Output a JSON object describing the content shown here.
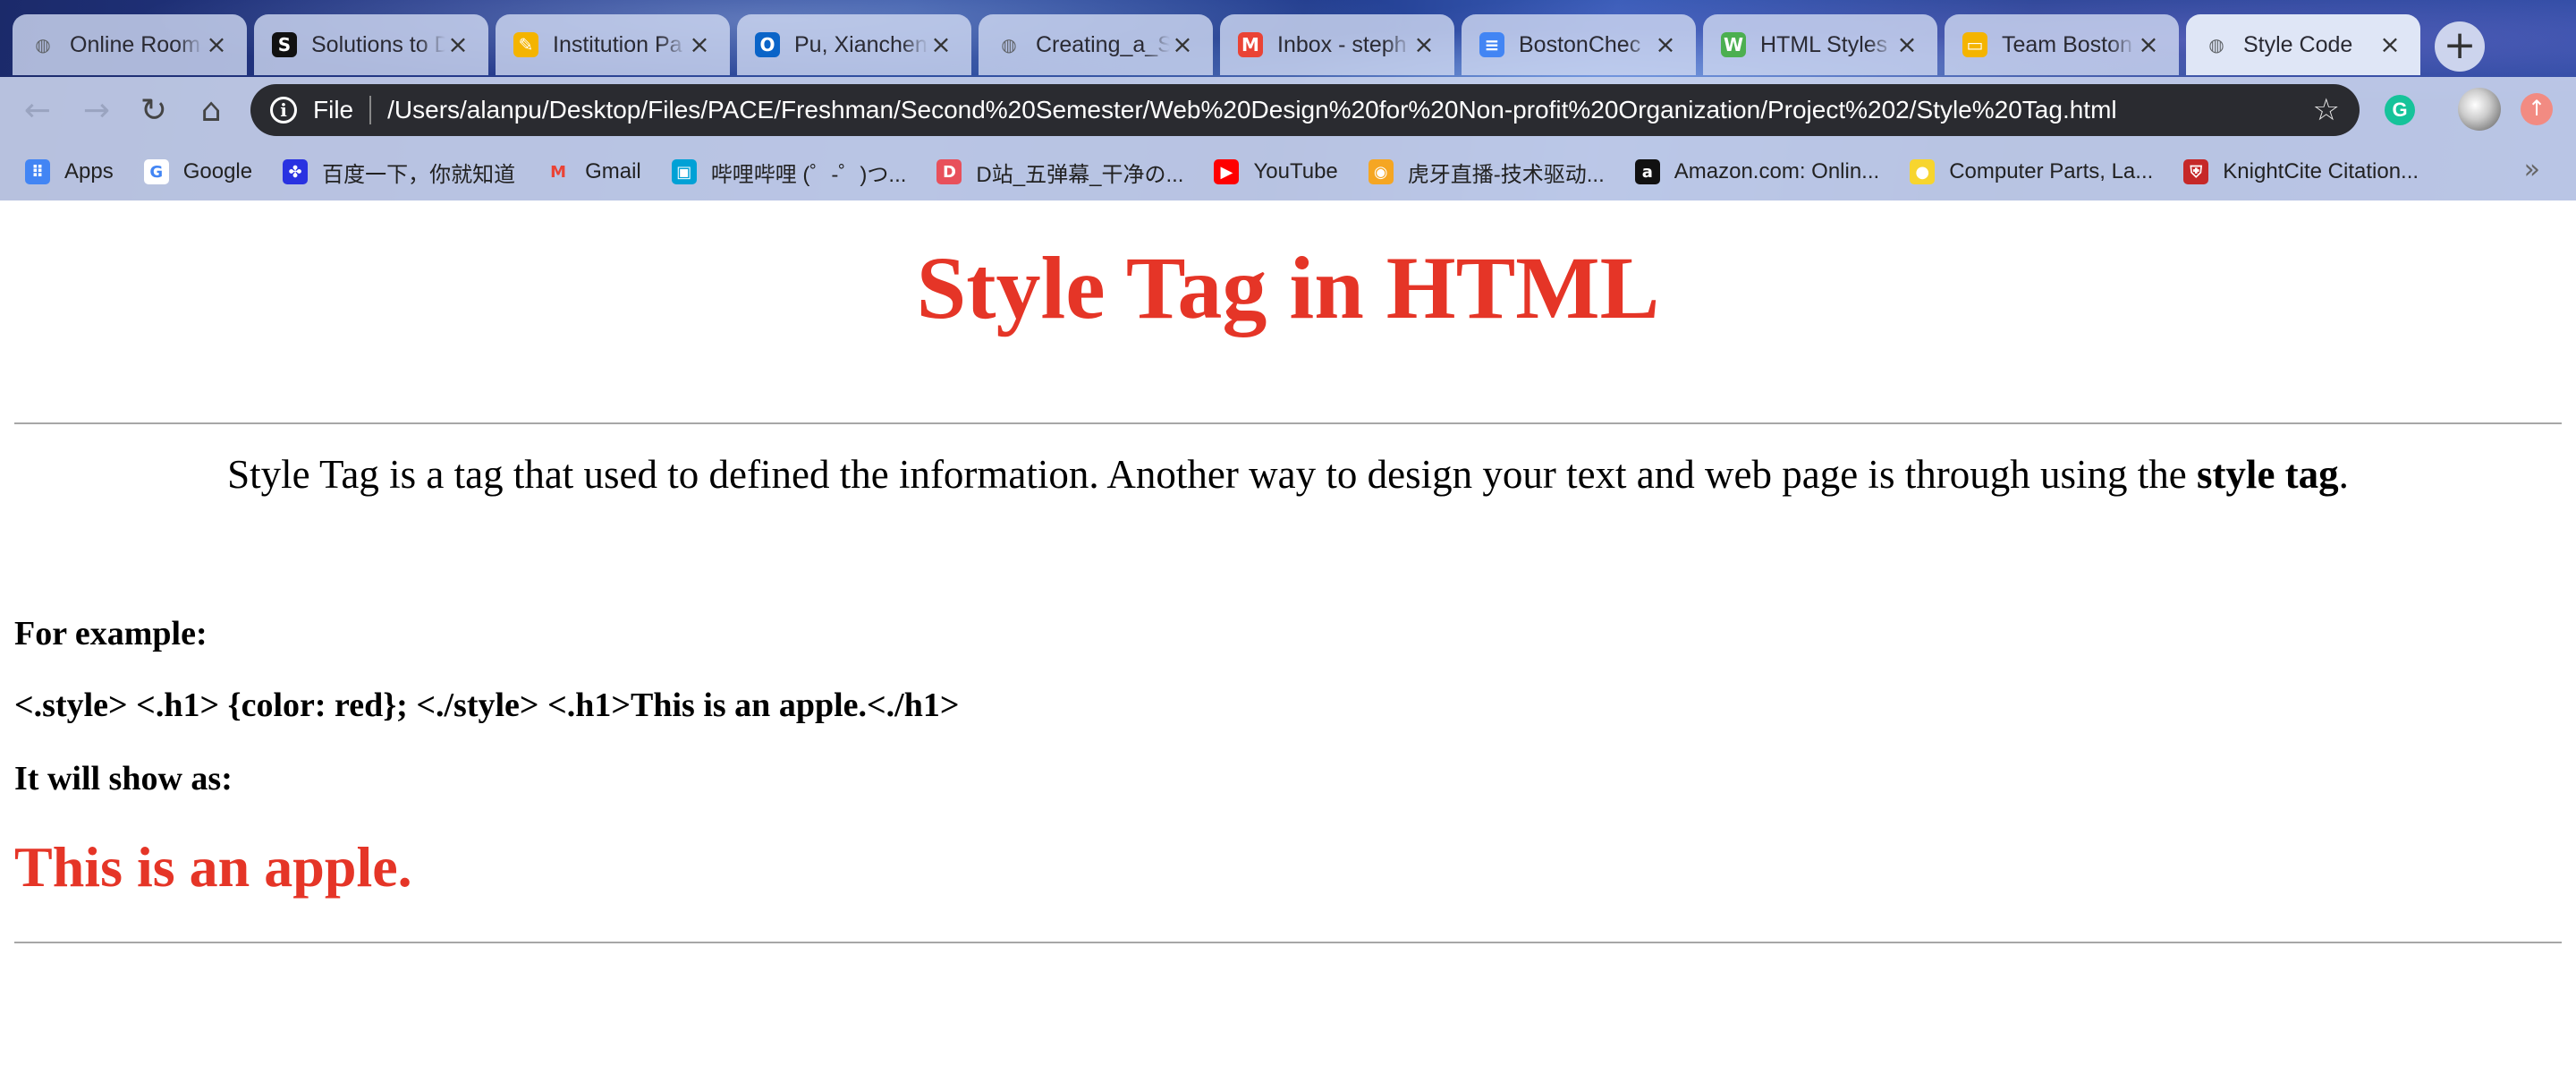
{
  "browser": {
    "tabs": [
      {
        "label": "Online Room",
        "icon": "globe-icon",
        "color": "#5f6368"
      },
      {
        "label": "Solutions to D",
        "icon": "s-logo-icon",
        "color": "#111111"
      },
      {
        "label": "Institution Pa",
        "icon": "pencil-icon",
        "color": "#f4b400"
      },
      {
        "label": "Pu, Xianchen",
        "icon": "outlook-icon",
        "color": "#0a64c8"
      },
      {
        "label": "Creating_a_S",
        "icon": "globe-icon",
        "color": "#5f6368"
      },
      {
        "label": "Inbox - steph",
        "icon": "gmail-icon",
        "color": "#ea4335"
      },
      {
        "label": "BostonChec",
        "icon": "docs-icon",
        "color": "#4285f4"
      },
      {
        "label": "HTML Styles",
        "icon": "w3-icon",
        "color": "#4caf50"
      },
      {
        "label": "Team Boston",
        "icon": "slides-icon",
        "color": "#f4b400"
      },
      {
        "label": "Style Code",
        "icon": "globe-icon",
        "color": "#5f6368"
      }
    ],
    "address": {
      "scheme": "File",
      "url": "/Users/alanpu/Desktop/Files/PACE/Freshman/Second%20Semester/Web%20Design%20for%20Non-profit%20Organization/Project%202/Style%20Tag.html"
    },
    "bookmarks": [
      {
        "label": "Apps",
        "icon": "apps-grid-icon",
        "color": "#4285f4"
      },
      {
        "label": "Google",
        "icon": "google-icon",
        "color": "#ffffff"
      },
      {
        "label": "百度一下，你就知道",
        "icon": "baidu-icon",
        "color": "#2932e1"
      },
      {
        "label": "Gmail",
        "icon": "gmail-icon",
        "color": "#ea4335"
      },
      {
        "label": "哔哩哔哩 (゜-゜)つ...",
        "icon": "bilibili-icon",
        "color": "#00a1d6"
      },
      {
        "label": "D站_五弹幕_干净の...",
        "icon": "d-site-icon",
        "color": "#e8505b"
      },
      {
        "label": "YouTube",
        "icon": "youtube-icon",
        "color": "#ff0000"
      },
      {
        "label": "虎牙直播-技术驱动...",
        "icon": "huya-icon",
        "color": "#f5a623"
      },
      {
        "label": "Amazon.com: Onlin...",
        "icon": "amazon-icon",
        "color": "#111111"
      },
      {
        "label": "Computer Parts, La...",
        "icon": "newegg-icon",
        "color": "#f7d52e"
      },
      {
        "label": "KnightCite Citation...",
        "icon": "shield-icon",
        "color": "#c62828"
      }
    ]
  },
  "page": {
    "title": "Style Tag in HTML",
    "intro_text": "Style Tag is a tag that used to defined the information. Another way to design your text and web page is through using the ",
    "intro_bold": "style tag",
    "intro_end": ".",
    "example_label": "For example:",
    "code_line": "<.style> <.h1> {color: red}; <./style> <.h1>This is an apple.<./h1>",
    "show_label": "It will show as:",
    "apple_text": "This is an apple.",
    "accent_color": "#e53527"
  }
}
